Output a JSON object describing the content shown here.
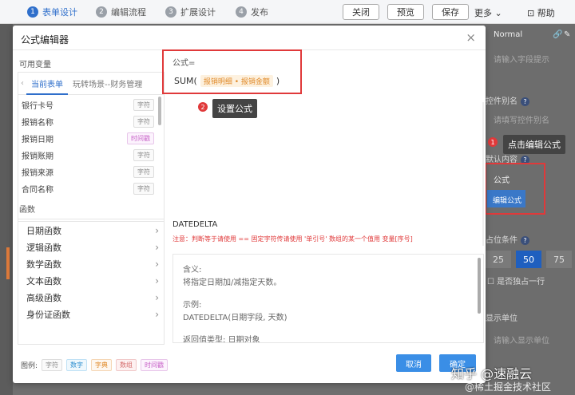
{
  "topbar": {
    "steps": [
      {
        "num": "1",
        "label": "表单设计"
      },
      {
        "num": "2",
        "label": "编辑流程"
      },
      {
        "num": "3",
        "label": "扩展设计"
      },
      {
        "num": "4",
        "label": "发布"
      }
    ],
    "buttons": {
      "close": "关闭",
      "preview": "预览",
      "save": "保存"
    },
    "more": "更多",
    "help": "帮助"
  },
  "right_panel": {
    "font_style": "Normal",
    "placeholder_hint": "请输入字段提示",
    "alias_label": "控件别名",
    "alias_placeholder": "请填写控件别名",
    "default_label": "默认内容",
    "formula_label": "公式",
    "edit_formula_btn": "编辑公式",
    "occupy_label": "占位条件",
    "seg_values": [
      "25",
      "50",
      "75"
    ],
    "exclusive_label": "是否独占一行",
    "unit_label": "显示单位",
    "unit_placeholder": "请输入显示单位"
  },
  "annotations": {
    "tip1_num": "1",
    "tip1": "点击编辑公式",
    "tip2_num": "2",
    "tip2": "设置公式"
  },
  "modal": {
    "title": "公式编辑器",
    "close": "×",
    "variables_label": "可用变量",
    "tabs": {
      "current": "当前表单",
      "other": "玩转场景--财务管理"
    },
    "variables": [
      {
        "name": "银行卡号",
        "type": "字符",
        "kind": "str"
      },
      {
        "name": "报销名称",
        "type": "字符",
        "kind": "str"
      },
      {
        "name": "报销日期",
        "type": "时间戳",
        "kind": "time"
      },
      {
        "name": "报销账期",
        "type": "字符",
        "kind": "str"
      },
      {
        "name": "报销来源",
        "type": "字符",
        "kind": "str"
      },
      {
        "name": "合同名称",
        "type": "字符",
        "kind": "str"
      }
    ],
    "functions_label": "函数",
    "functions": [
      "日期函数",
      "逻辑函数",
      "数学函数",
      "文本函数",
      "高级函数",
      "身份证函数"
    ],
    "formula_label": "公式=",
    "formula_prefix": "SUM(",
    "formula_tag": "报销明细 • 报销金额",
    "formula_suffix": ")",
    "desc_title": "DATEDELTA",
    "desc_note": "注意：判断等于请使用 == 固定字符传请使用 '单引号' 数组的某一个值用 变量[序号]",
    "desc_lines": {
      "meaning_label": "含义:",
      "meaning": "将指定日期加/减指定天数。",
      "example_label": "示例:",
      "example": "DATEDELTA(日期字段, 天数)",
      "return_label": "返回值类型: 日期对象"
    },
    "legend": {
      "label": "图例:",
      "str": "字符",
      "num": "数字",
      "dict": "字典",
      "array": "数组",
      "time": "时间戳"
    },
    "cancel": "取消",
    "confirm": "确定"
  },
  "watermark": {
    "main": "知乎 @速融云",
    "sub": "@稀土掘金技术社区"
  },
  "colors": {
    "accent": "#2f6fcb",
    "red": "#e0393a",
    "button": "#3a8ee6"
  }
}
